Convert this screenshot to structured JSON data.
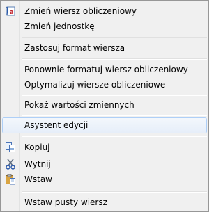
{
  "menu": {
    "items": [
      {
        "label": "Zmień wiersz obliczeniowy",
        "icon": "formula-row-icon"
      },
      {
        "label": "Zmień jednostkę"
      },
      {
        "label": "Zastosuj format wiersza"
      },
      {
        "label": "Ponownie formatuj wiersz obliczeniowy"
      },
      {
        "label": "Optymalizuj wiersze obliczeniowe"
      },
      {
        "label": "Pokaż wartości zmiennych"
      },
      {
        "label": "Asystent edycji"
      },
      {
        "label": "Kopiuj",
        "icon": "copy-icon"
      },
      {
        "label": "Wytnij",
        "icon": "cut-icon"
      },
      {
        "label": "Wstaw",
        "icon": "paste-icon"
      },
      {
        "label": "Wstaw pusty wiersz"
      }
    ],
    "highlighted": "Asystent edycji"
  }
}
